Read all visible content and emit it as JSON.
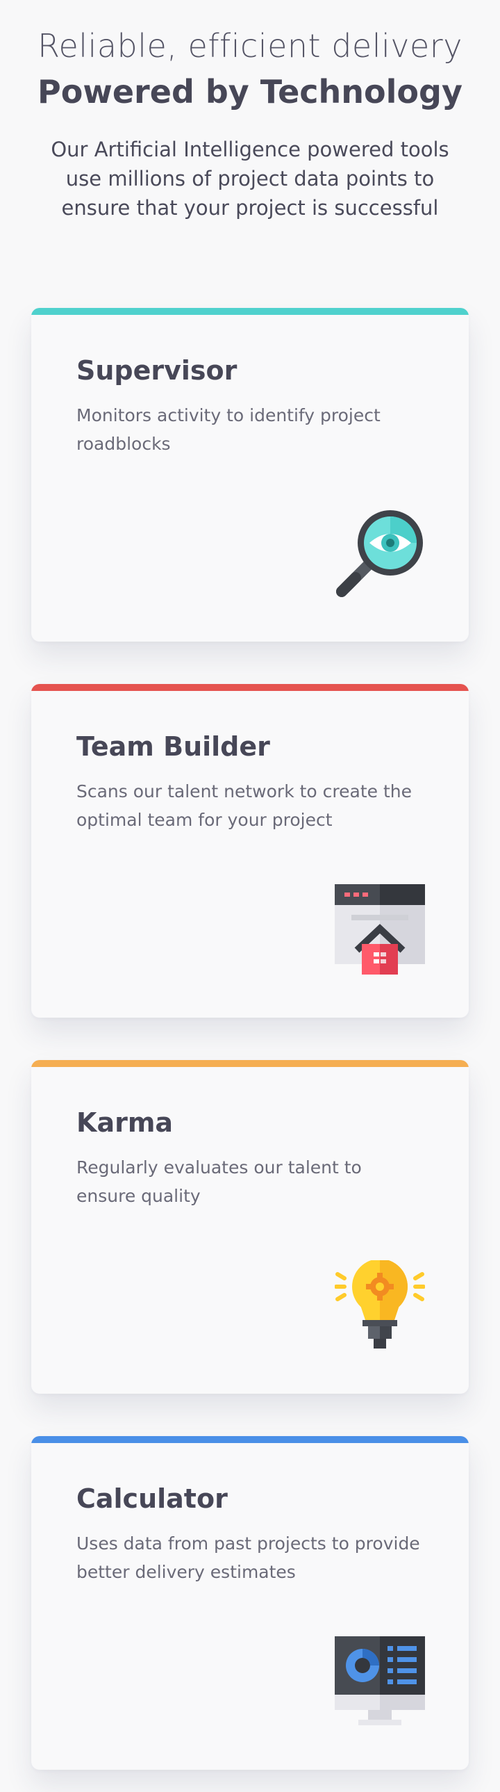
{
  "hero": {
    "title_line1": "Reliable, efficient delivery",
    "title_line2": "Powered by Technology",
    "subtitle": "Our Artificial Intelligence powered tools use millions of project data points to ensure that your project is successful"
  },
  "cards": [
    {
      "title": "Supervisor",
      "description": "Monitors activity to identify project roadblocks",
      "accent": "#4fd1cd",
      "icon": "magnifier-eye-icon"
    },
    {
      "title": "Team Builder",
      "description": "Scans our talent network to create the optimal team for your project",
      "accent": "#e5534f",
      "icon": "browser-house-icon"
    },
    {
      "title": "Karma",
      "description": "Regularly evaluates our talent to ensure quality",
      "accent": "#f5ae52",
      "icon": "lightbulb-gear-icon"
    },
    {
      "title": "Calculator",
      "description": "Uses data from past projects to provide better delivery estimates",
      "accent": "#4a8fe7",
      "icon": "monitor-dashboard-icon"
    }
  ]
}
